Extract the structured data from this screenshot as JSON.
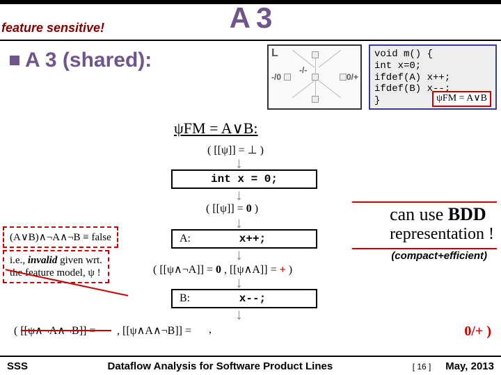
{
  "header": {
    "title": "A 3",
    "feature_sensitive": "feature sensitive!",
    "a3_shared": "A 3 (shared):"
  },
  "diagram": {
    "label_L": "L",
    "edge_left": "-/0",
    "edge_mid": "-/-",
    "edge_right": "0/+"
  },
  "code": {
    "l1": "void m() {",
    "l2": "  int x=0;",
    "l3": "  ifdef(A) x++;",
    "l4": "  ifdef(B) x--;",
    "l5": "}",
    "psi_fm": "ψFM = A∨B"
  },
  "psi_heading": "ψFM = A∨B:",
  "annotations": {
    "top_bot": "( [[ψ]] = ⊥ )",
    "zero": "( [[ψ]] = 0 )",
    "afterA": "( [[ψ∧¬A]] = 0 , [[ψ∧A]] = + )",
    "final_left": "( [[ψ∧¬A∧¬B]] = ",
    "final_mid": ", [[ψ∧A∧¬B]] = ",
    "final_tail": ",",
    "final_right": "0/+  )"
  },
  "statements": {
    "intx": "int x = 0;",
    "A_label": "A:",
    "xpp": "x++;",
    "B_label": "B:",
    "xmm": "x--;"
  },
  "leftnotes": {
    "eq_false": "(A∨B)∧¬A∧¬B ≡ false",
    "invalid_l1": "i.e., invalid given wrt.",
    "invalid_l2": "the feature model, ψ !"
  },
  "bdd": {
    "line1a": "can use ",
    "line1b": "BDD",
    "line2": "representation !",
    "compact": "(compact+efficient)"
  },
  "footer": {
    "left": "SSS",
    "center": "Dataflow Analysis for Software Product Lines",
    "page": "[ 16 ]",
    "right": "May, 2013"
  }
}
